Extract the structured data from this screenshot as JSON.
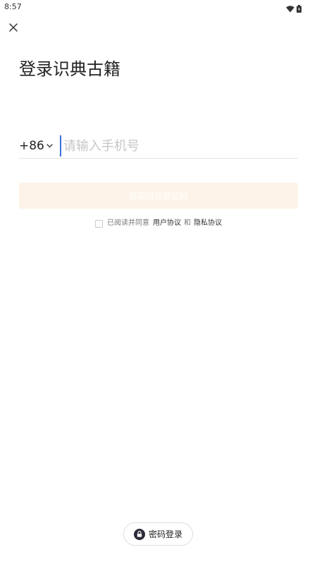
{
  "status_bar": {
    "time": "8:57",
    "icons": [
      "wifi-icon",
      "battery-icon"
    ]
  },
  "header": {
    "close_icon": "close-icon",
    "title": "登录识典古籍"
  },
  "phone_form": {
    "country_code": "+86",
    "country_chevron_icon": "chevron-down-icon",
    "placeholder": "请输入手机号",
    "value": ""
  },
  "sms_button": {
    "label": "获取短信验证码",
    "background_color": "#fdf3e8"
  },
  "agreement": {
    "checked": false,
    "prefix": "已阅读并同意",
    "user_agreement": "用户协议",
    "conjunction": "和",
    "privacy_policy": "隐私协议"
  },
  "footer": {
    "password_login_label": "密码登录",
    "lock_icon": "lock-icon"
  },
  "colors": {
    "cursor": "#3a6ed8",
    "placeholder": "#c6c6c6",
    "divider": "#e3e3e3"
  }
}
